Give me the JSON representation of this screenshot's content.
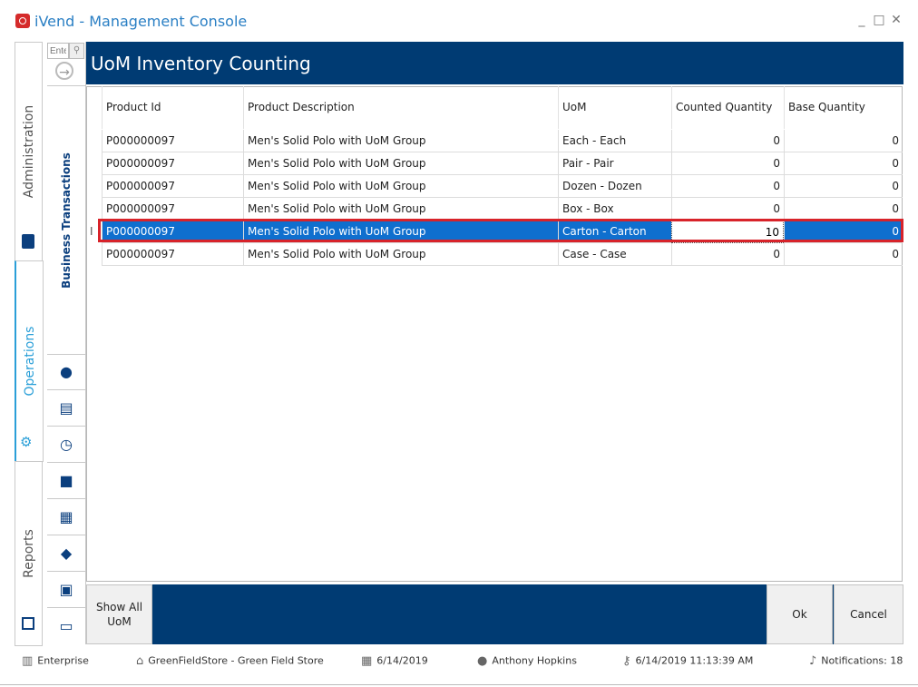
{
  "window": {
    "title": "iVend - Management Console",
    "minimize": "_",
    "maximize": "□",
    "close": "✕"
  },
  "vtabs": {
    "administration": "Administration",
    "operations": "Operations",
    "reports": "Reports"
  },
  "nav": {
    "search_placeholder": "Ente",
    "section_label": "Business Transactions",
    "icons": [
      "money-user-icon",
      "register-icon",
      "clock-icon",
      "gift-icon",
      "warehouse-icon",
      "tag-icon",
      "store-money-icon",
      "gift-card-icon"
    ]
  },
  "page": {
    "title": "UoM Inventory Counting"
  },
  "grid": {
    "columns": [
      "Product Id",
      "Product Description",
      "UoM",
      "Counted Quantity",
      "Base Quantity"
    ],
    "rows": [
      {
        "product_id": "P000000097",
        "description": "Men's Solid Polo with UoM Group",
        "uom": "Each - Each",
        "counted": "0",
        "base": "0"
      },
      {
        "product_id": "P000000097",
        "description": "Men's Solid Polo with UoM Group",
        "uom": "Pair - Pair",
        "counted": "0",
        "base": "0"
      },
      {
        "product_id": "P000000097",
        "description": "Men's Solid Polo with UoM Group",
        "uom": "Dozen - Dozen",
        "counted": "0",
        "base": "0"
      },
      {
        "product_id": "P000000097",
        "description": "Men's Solid Polo with UoM Group",
        "uom": "Box - Box",
        "counted": "0",
        "base": "0"
      },
      {
        "product_id": "P000000097",
        "description": "Men's Solid Polo with UoM Group",
        "uom": "Carton - Carton",
        "counted": "10",
        "base": "0"
      },
      {
        "product_id": "P000000097",
        "description": "Men's Solid Polo with UoM Group",
        "uom": "Case - Case",
        "counted": "0",
        "base": "0"
      }
    ],
    "selected_row": 4,
    "row_indicator": "I"
  },
  "buttons": {
    "show_all_uom": "Show All UoM",
    "ok": "Ok",
    "cancel": "Cancel"
  },
  "status": {
    "company": "Enterprise",
    "store": "GreenFieldStore - Green Field Store",
    "date": "6/14/2019",
    "user": "Anthony Hopkins",
    "timestamp": "6/14/2019 11:13:39 AM",
    "notifications": "Notifications: 18"
  },
  "colors": {
    "header_bg": "#003b73",
    "selection": "#0f6fce",
    "highlight_outline": "#d8232a",
    "accent": "#2a7fc4"
  }
}
